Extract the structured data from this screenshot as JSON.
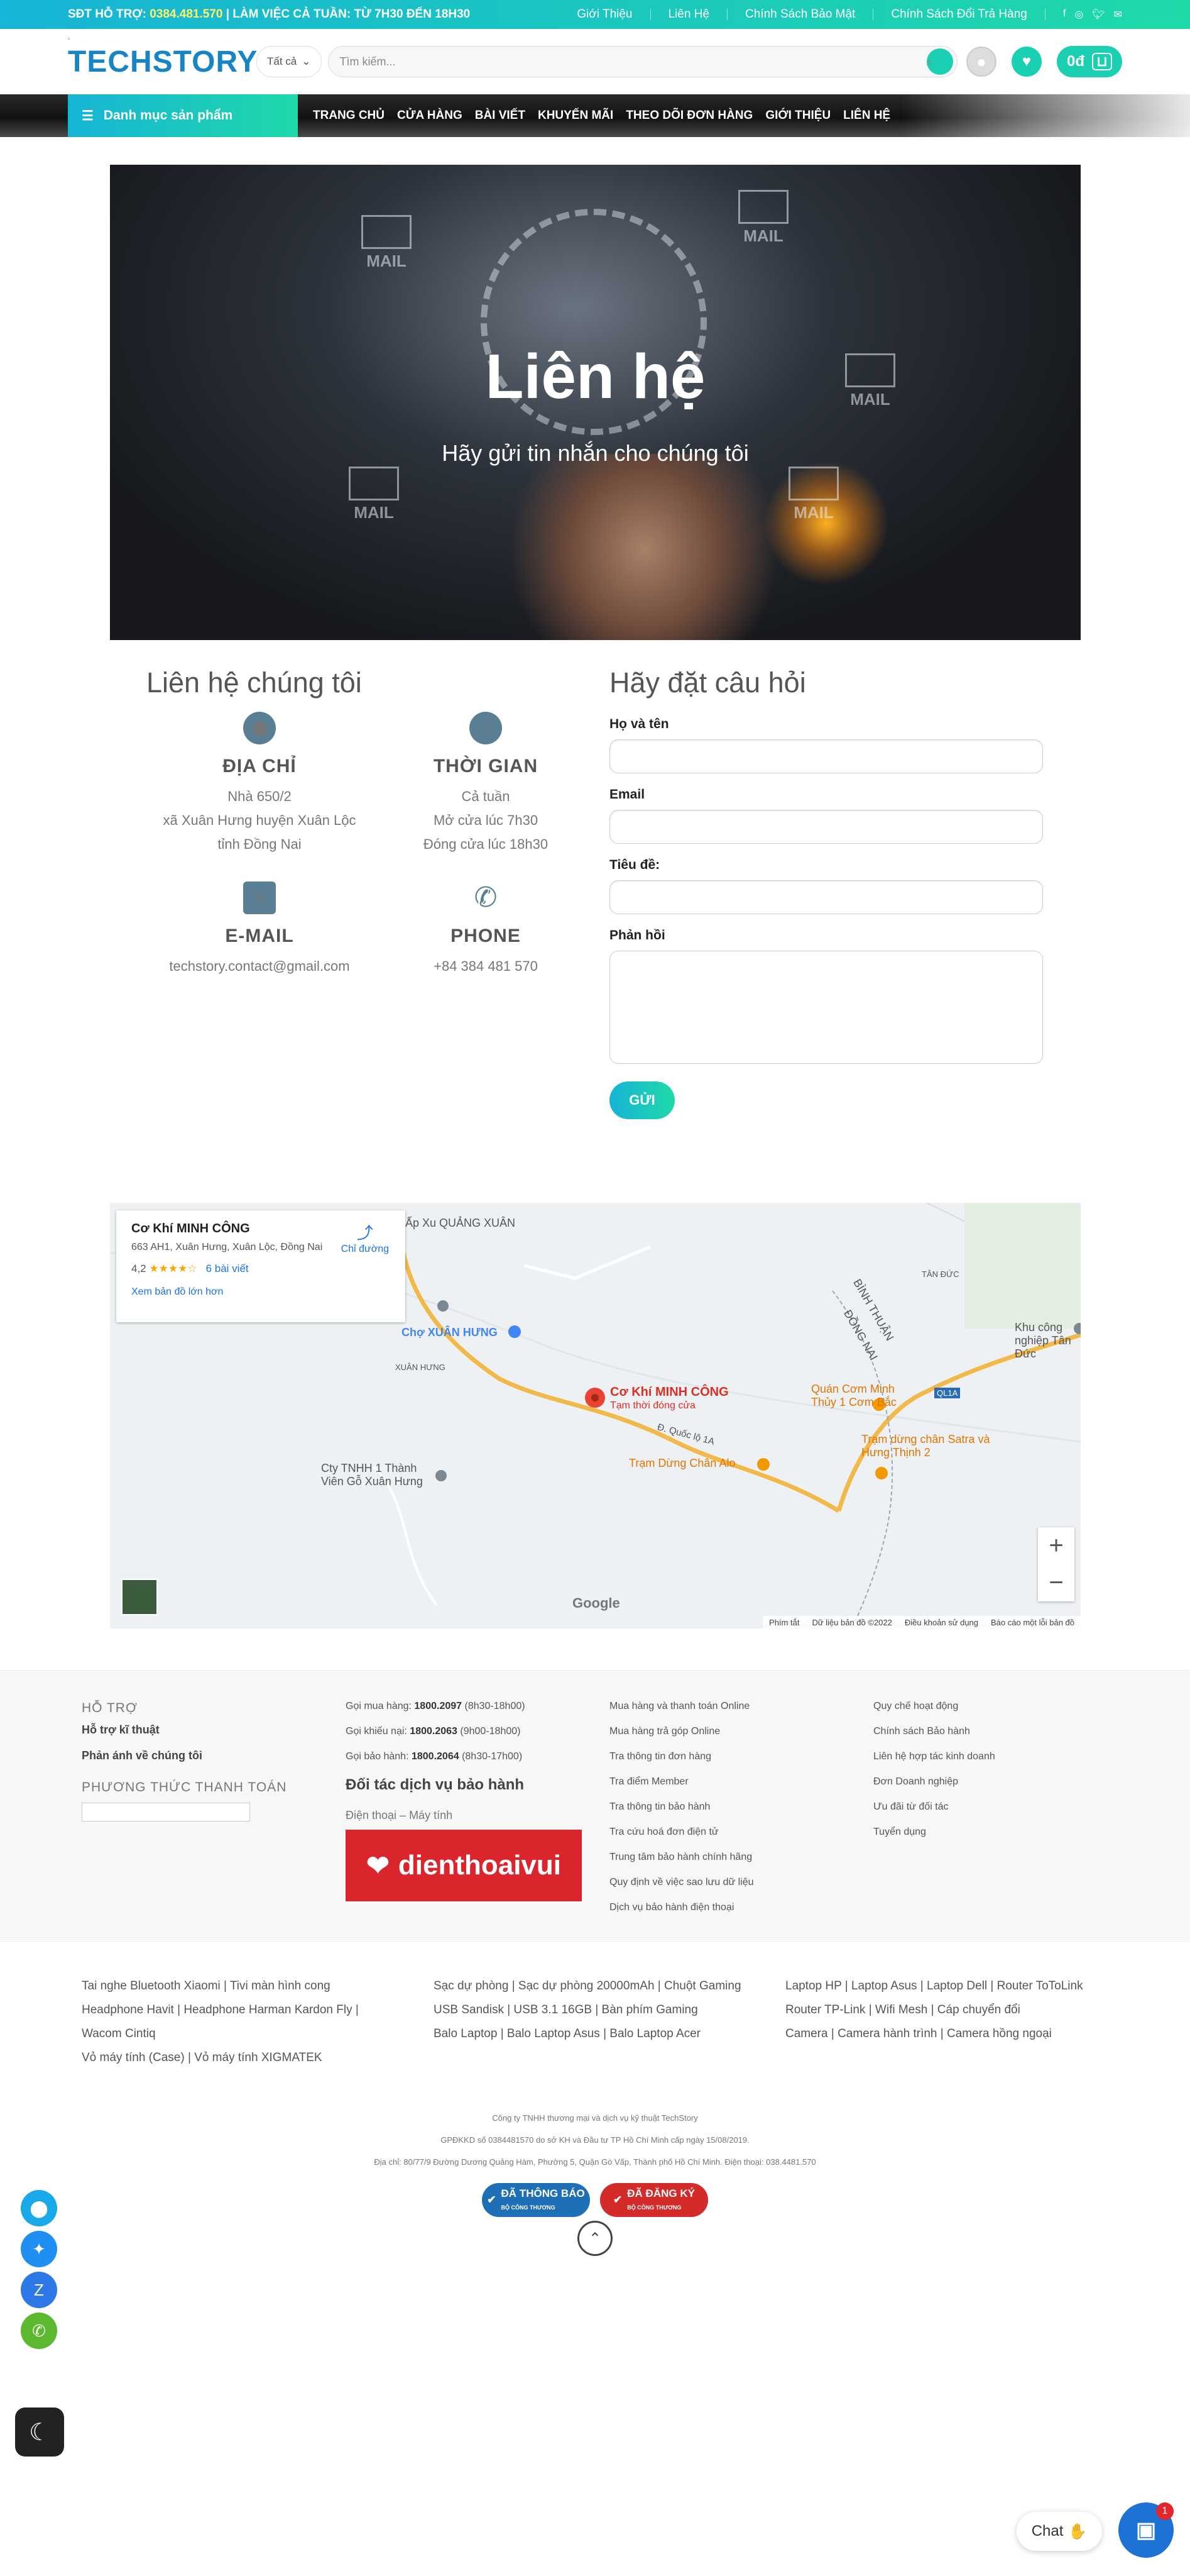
{
  "topbar": {
    "support_label": "SĐT HỖ TRỢ:",
    "support_phone": "0384.481.570",
    "hours": "| LÀM VIỆC CẢ TUẦN: TỪ 7H30 ĐẾN 18H30",
    "links": [
      "Giới Thiệu",
      "Liên Hệ",
      "Chính Sách Bảo Mật",
      "Chính Sách Đổi Trả Hàng"
    ],
    "social_icons": [
      "facebook-icon",
      "instagram-icon",
      "twitter-icon",
      "email-icon"
    ]
  },
  "header": {
    "logo": "TECHSTORY",
    "category_select": "Tất cả",
    "search_placeholder": "Tìm kiếm...",
    "cart_total": "0đ"
  },
  "nav": {
    "category_menu": "Danh mục sản phẩm",
    "items": [
      "TRANG CHỦ",
      "CỬA HÀNG",
      "BÀI VIẾT",
      "KHUYẾN MÃI",
      "THEO DÕI ĐƠN HÀNG",
      "GIỚI THIỆU",
      "LIÊN HỆ"
    ]
  },
  "hero": {
    "title": "Liên hệ",
    "subtitle": "Hãy gửi tin nhắn cho chúng tôi",
    "env_text": "MAIL"
  },
  "contact": {
    "heading": "Liên hệ chúng tôi",
    "address": {
      "title": "ĐỊA CHỈ",
      "lines": [
        "Nhà 650/2",
        "xã Xuân Hưng huyện Xuân Lộc",
        "tỉnh Đồng Nai"
      ]
    },
    "time": {
      "title": "THỜI GIAN",
      "lines": [
        "Cả tuần",
        "Mở cửa lúc 7h30",
        "Đóng cửa lúc 18h30"
      ]
    },
    "email": {
      "title": "E-MAIL",
      "lines": [
        "techstory.contact@gmail.com"
      ]
    },
    "phone": {
      "title": "PHONE",
      "lines": [
        "+84 384 481 570"
      ]
    }
  },
  "form": {
    "heading": "Hãy đặt câu hỏi",
    "name_label": "Họ và tên",
    "email_label": "Email",
    "subject_label": "Tiêu đề:",
    "message_label": "Phản hồi",
    "submit": "GỬI"
  },
  "map": {
    "place": "Cơ Khí MINH CÔNG",
    "address": "663 AH1, Xuân Hưng, Xuân Lộc, Đồng Nai",
    "rating": "4,2",
    "stars": "★★★★☆",
    "reviews": "6 bài viết",
    "directions": "Chỉ đường",
    "larger_map": "Xem bản đồ lớn hơn",
    "pin_label": "Cơ Khí MINH CÔNG",
    "pin_sub": "Tạm thời đóng cửa",
    "labels": {
      "l1": "Ấp Xu QUẢNG XUÂN",
      "l2": "Chợ XUÂN HƯNG",
      "l3": "XUÂN HƯNG",
      "l4": "Cty TNHH 1 Thành Viên Gỗ Xuân Hưng",
      "l5": "Trạm Dừng Chân Alo",
      "l6": "Quán Cơm Minh Thủy 1 Cơm Bắc",
      "l7": "Trạm dừng chân Satra và Hưng Thịnh 2",
      "l8": "Khu công nghiệp Tân Đức",
      "l9": "TÂN ĐỨC",
      "l10": "BÌNH THUẬN",
      "l11": "ĐỒNG NAI",
      "l12": "QL1A",
      "l13": "Đ. Quốc lộ 1A"
    },
    "google": "Google",
    "attribution": [
      "Phím tắt",
      "Dữ liệu bản đồ ©2022",
      "Điều khoản sử dụng",
      "Báo cáo một lỗi bản đồ"
    ]
  },
  "footer": {
    "support_heading": "HỖ TRỢ",
    "support_links": [
      "Hỗ trợ kĩ thuật",
      "Phản ánh về chúng tôi"
    ],
    "payment_heading": "PHƯƠNG THỨC THANH TOÁN",
    "hotlines": [
      {
        "label": "Gọi mua hàng:",
        "number": "1800.2097",
        "hours": "(8h30-18h00)"
      },
      {
        "label": "Gọi khiếu nại:",
        "number": "1800.2063",
        "hours": "(9h00-18h00)"
      },
      {
        "label": "Gọi bảo hành:",
        "number": "1800.2064",
        "hours": "(8h30-17h00)"
      }
    ],
    "partner_heading": "Đối tác dịch vụ bảo hành",
    "partner_sub": "Điện thoại – Máy tính",
    "partner_logo": "dienthoaivui",
    "col3": [
      "Mua hàng và thanh toán Online",
      "Mua hàng trả góp Online",
      "Tra thông tin đơn hàng",
      "Tra điểm Member",
      "Tra thông tin bảo hành",
      "Tra cứu hoá đơn điện tử",
      "Trung tâm bảo hành chính hãng",
      "Quy định về việc sao lưu dữ liệu",
      "Dịch vụ bảo hành điện thoại"
    ],
    "col4": [
      "Quy chế hoạt động",
      "Chính sách Bảo hành",
      "Liên hệ hợp tác kinh doanh",
      "Đơn Doanh nghiệp",
      "Ưu đãi từ đối tác",
      "Tuyển dụng"
    ]
  },
  "tags": {
    "col1": [
      "Tai nghe Bluetooth Xiaomi | Tivi màn hình cong",
      "Headphone Havit | Headphone Harman Kardon Fly |",
      "Wacom Cintiq",
      "Vỏ máy tính (Case) | Vỏ máy tính XIGMATEK"
    ],
    "col2": [
      "Sạc dự phòng | Sạc dự phòng 20000mAh | Chuột Gaming",
      "USB Sandisk | USB 3.1 16GB | Bàn phím Gaming",
      "Balo Laptop | Balo Laptop Asus | Balo Laptop Acer"
    ],
    "col3": [
      "Laptop HP | Laptop Asus | Laptop Dell | Router ToToLink",
      "Router TP-Link | Wifi Mesh | Cáp chuyển đổi",
      "Camera | Camera hành trình | Camera hồng ngoại"
    ]
  },
  "bottom": {
    "lines": [
      "Công ty TNHH thương mại và dịch vụ kỹ thuật TechStory",
      "GPĐKKD số 0384481570 do sở KH và Đầu tư TP Hồ Chí Minh cấp ngày 15/08/2019.",
      "Địa chỉ: 80/77/9 Đường Dương Quảng Hàm, Phường 5, Quận Gò Vấp, Thành phố Hồ Chí Minh. Điện thoại: 038.4481.570"
    ],
    "badge1": "ĐÃ THÔNG BÁO",
    "badge1_sub": "BỘ CÔNG THƯƠNG",
    "badge2": "ĐÃ ĐĂNG KÝ",
    "badge2_sub": "BỘ CÔNG THƯƠNG"
  },
  "chat": {
    "label": "Chat",
    "badge": "1"
  },
  "colors": {
    "accent": "#1bd0b2",
    "accent2": "#16b4d6",
    "icon": "#5a7f95"
  }
}
